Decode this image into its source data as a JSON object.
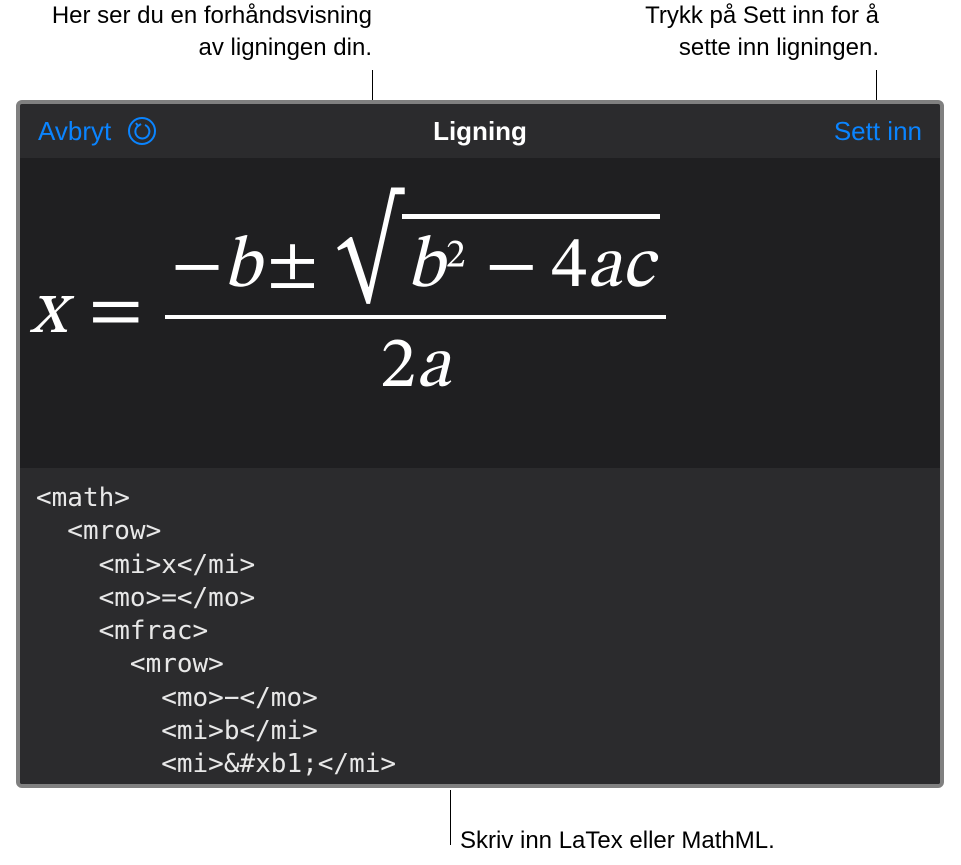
{
  "callouts": {
    "preview": "Her ser du en forhåndsvisning\nav ligningen din.",
    "insert": "Trykk på Sett inn for å\nsette inn ligningen.",
    "code": "Skriv inn LaTex eller MathML."
  },
  "nav": {
    "cancel_label": "Avbryt",
    "title": "Ligning",
    "insert_label": "Sett inn"
  },
  "equation": {
    "parts": {
      "x": "x",
      "eq": "=",
      "neg": "−",
      "b": "b",
      "pm": "±",
      "sq": "2",
      "minus": "−",
      "four": "4",
      "a": "a",
      "c": "c",
      "two": "2"
    },
    "latex_equivalent": "x = \\frac{-b \\pm \\sqrt{b^{2} - 4ac}}{2a}"
  },
  "code_text": "<math>\n  <mrow>\n    <mi>x</mi>\n    <mo>=</mo>\n    <mfrac>\n      <mrow>\n        <mo>−</mo>\n        <mi>b</mi>\n        <mi>&#xb1;</mi>"
}
